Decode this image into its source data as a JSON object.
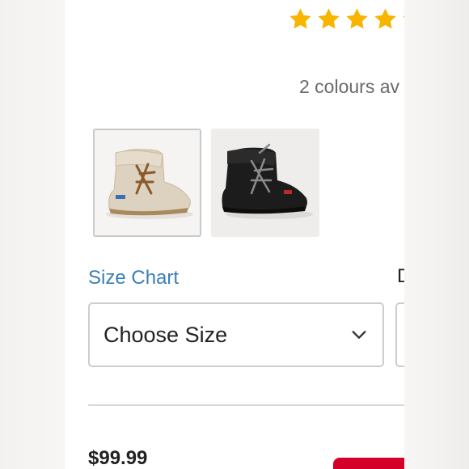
{
  "rating": {
    "stars": 5
  },
  "colors": {
    "count_text": "2 colours av",
    "swatches": [
      {
        "name": "tan-moccasin-boot",
        "selected": true
      },
      {
        "name": "black-moccasin-boot",
        "selected": false
      }
    ]
  },
  "size": {
    "chart_link": "Size Chart",
    "select_value": "Choose Size"
  },
  "second_select": {
    "label": "D"
  },
  "price": "$99.99",
  "theme": {
    "star_color": "#f7b500",
    "link_color": "#3a7fb6",
    "cta_color": "#d4002a"
  }
}
